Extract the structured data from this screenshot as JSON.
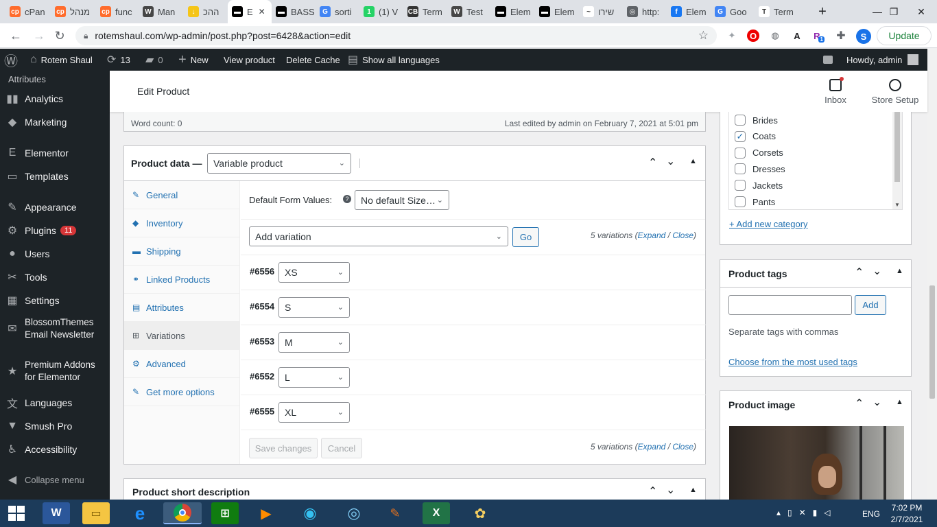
{
  "browser": {
    "tabs": [
      {
        "label": "cPan",
        "color": "#ff6c2c",
        "glyph": "cp"
      },
      {
        "label": "מנהל",
        "color": "#ff6c2c",
        "glyph": "cp"
      },
      {
        "label": "func",
        "color": "#ff6c2c",
        "glyph": "cp"
      },
      {
        "label": "Man",
        "color": "#464646",
        "glyph": "W"
      },
      {
        "label": "ההכ",
        "color": "#f5c518",
        "glyph": "↓"
      },
      {
        "label": "E",
        "color": "#000000",
        "glyph": "▬"
      },
      {
        "label": "BASS",
        "color": "#000000",
        "glyph": "▬"
      },
      {
        "label": "sorti",
        "color": "#4285f4",
        "glyph": "G"
      },
      {
        "label": "(1) V",
        "color": "#25d366",
        "glyph": "1"
      },
      {
        "label": "Term",
        "color": "#333333",
        "glyph": "CB"
      },
      {
        "label": "Test",
        "color": "#464646",
        "glyph": "W"
      },
      {
        "label": "Elem",
        "color": "#000000",
        "glyph": "▬"
      },
      {
        "label": "Elem",
        "color": "#000000",
        "glyph": "▬"
      },
      {
        "label": "שירו",
        "color": "#ffffff",
        "glyph": "~"
      },
      {
        "label": "http:",
        "color": "#5f6368",
        "glyph": "◎"
      },
      {
        "label": "Elem",
        "color": "#1877f2",
        "glyph": "f"
      },
      {
        "label": "Goo",
        "color": "#4285f4",
        "glyph": "G"
      },
      {
        "label": "Term",
        "color": "#ffffff",
        "glyph": "T"
      }
    ],
    "new_tab": "+",
    "url": "rotemshaul.com/wp-admin/post.php?post=6428&action=edit",
    "update_label": "Update",
    "profile_letter": "S",
    "ext_badge": "1"
  },
  "adminbar": {
    "site_name": "Rotem Shaul",
    "updates_count": "13",
    "comments_count": "0",
    "new_label": "New",
    "view_product": "View product",
    "delete_cache": "Delete Cache",
    "show_languages": "Show all languages",
    "howdy": "Howdy, admin"
  },
  "sidebar": {
    "top_item": "Attributes",
    "items": [
      {
        "label": "Analytics",
        "icon": "▮▮"
      },
      {
        "label": "Marketing",
        "icon": "◆"
      },
      {
        "label": "Elementor",
        "icon": "E"
      },
      {
        "label": "Templates",
        "icon": "▭"
      },
      {
        "label": "Appearance",
        "icon": "✎"
      },
      {
        "label": "Plugins",
        "icon": "⚙",
        "badge": "11"
      },
      {
        "label": "Users",
        "icon": "●"
      },
      {
        "label": "Tools",
        "icon": "✂"
      },
      {
        "label": "Settings",
        "icon": "▦"
      },
      {
        "label": "BlossomThemes Email Newsletter",
        "icon": "✉"
      },
      {
        "label": "Premium Addons for Elementor",
        "icon": "★"
      },
      {
        "label": "Languages",
        "icon": "文"
      },
      {
        "label": "Smush Pro",
        "icon": "▼"
      },
      {
        "label": "Accessibility",
        "icon": "♿"
      }
    ],
    "collapse": "Collapse menu"
  },
  "header": {
    "title": "Edit Product",
    "inbox": "Inbox",
    "store_setup": "Store Setup"
  },
  "editor": {
    "word_count": "Word count: 0",
    "last_edited": "Last edited by admin on February 7, 2021 at 5:01 pm"
  },
  "product_data": {
    "title": "Product data —",
    "type": "Variable product",
    "tabs": [
      {
        "label": "General",
        "icon": "✎"
      },
      {
        "label": "Inventory",
        "icon": "◆"
      },
      {
        "label": "Shipping",
        "icon": "▬"
      },
      {
        "label": "Linked Products",
        "icon": "⚭"
      },
      {
        "label": "Attributes",
        "icon": "▤"
      },
      {
        "label": "Variations",
        "icon": "⊞",
        "active": true
      },
      {
        "label": "Advanced",
        "icon": "⚙"
      },
      {
        "label": "Get more options",
        "icon": "✎"
      }
    ],
    "default_form_label": "Default Form Values:",
    "default_form_value": "No default Size…",
    "add_variation": "Add variation",
    "go": "Go",
    "variations_count": "5 variations",
    "expand": "Expand",
    "close": "Close",
    "variations": [
      {
        "id": "#6556",
        "size": "XS"
      },
      {
        "id": "#6554",
        "size": "S"
      },
      {
        "id": "#6553",
        "size": "M"
      },
      {
        "id": "#6552",
        "size": "L"
      },
      {
        "id": "#6555",
        "size": "XL"
      }
    ],
    "save_changes": "Save changes",
    "cancel": "Cancel"
  },
  "short_description": {
    "title": "Product short description"
  },
  "categories": {
    "items": [
      {
        "label": "Brides",
        "checked": false
      },
      {
        "label": "Coats",
        "checked": true
      },
      {
        "label": "Corsets",
        "checked": false
      },
      {
        "label": "Dresses",
        "checked": false
      },
      {
        "label": "Jackets",
        "checked": false
      },
      {
        "label": "Pants",
        "checked": false
      }
    ],
    "add_new": "+ Add new category"
  },
  "tags": {
    "title": "Product tags",
    "add": "Add",
    "hint": "Separate tags with commas",
    "choose": "Choose from the most used tags"
  },
  "product_image": {
    "title": "Product image"
  },
  "taskbar": {
    "lang": "ENG",
    "time": "7:02 PM",
    "date": "2/7/2021"
  },
  "colors": {
    "accent": "#2271b1",
    "adminbar": "#1d2327",
    "badge": "#d63638"
  }
}
